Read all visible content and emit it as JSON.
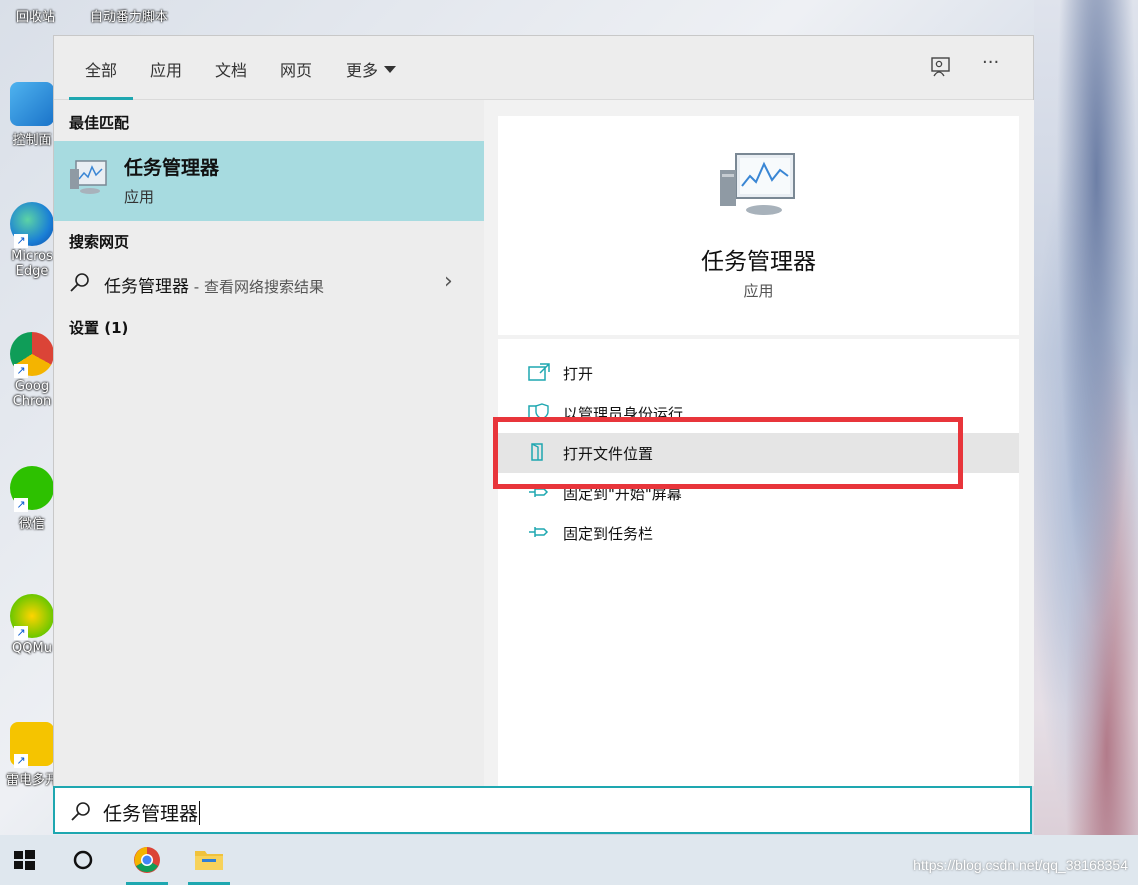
{
  "desktop": {
    "top_labels": [
      "回收站",
      "自动番力脚本"
    ],
    "icons": [
      {
        "label": "控制面"
      },
      {
        "label": "Micros Edge"
      },
      {
        "label": "Goog Chron"
      },
      {
        "label": "微信"
      },
      {
        "label": "QQMu"
      },
      {
        "label": "雷电多开"
      }
    ]
  },
  "tabs": [
    {
      "label": "全部",
      "active": true
    },
    {
      "label": "应用"
    },
    {
      "label": "文档"
    },
    {
      "label": "网页"
    },
    {
      "label": "更多"
    }
  ],
  "top_actions": {
    "feedback_icon": "feedback-icon",
    "more_icon": "ellipsis-icon",
    "more_glyph": "···"
  },
  "left": {
    "best_match_heading": "最佳匹配",
    "best_match": {
      "title": "任务管理器",
      "subtitle": "应用"
    },
    "web_heading": "搜索网页",
    "web_result": {
      "term": "任务管理器",
      "hint": " - 查看网络搜索结果"
    },
    "settings_heading": "设置 (1)"
  },
  "preview": {
    "title": "任务管理器",
    "subtitle": "应用"
  },
  "actions": [
    {
      "label": "打开",
      "icon": "open-icon"
    },
    {
      "label": "以管理员身份运行",
      "icon": "shield-icon"
    },
    {
      "label": "打开文件位置",
      "icon": "folder-icon"
    },
    {
      "label": "固定到\"开始\"屏幕",
      "icon": "pin-start-icon"
    },
    {
      "label": "固定到任务栏",
      "icon": "pin-taskbar-icon"
    }
  ],
  "search": {
    "value": "任务管理器"
  },
  "watermark": "https://blog.csdn.net/qq_38168354",
  "colors": {
    "accent": "#1ea7b0",
    "highlight": "#a7dbe0",
    "annotation": "#e8353b"
  }
}
